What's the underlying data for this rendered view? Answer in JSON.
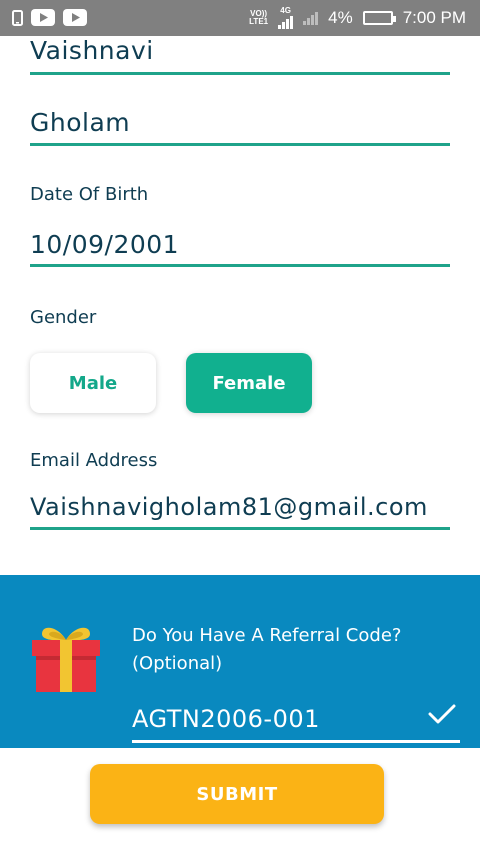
{
  "status_bar": {
    "network_top": "VO))",
    "network_bottom": "LTE1",
    "network_type": "4G",
    "battery": "4%",
    "time": "7:00 PM"
  },
  "form": {
    "first_name": "Vaishnavi",
    "last_name": "Gholam",
    "dob_label": "Date Of Birth",
    "dob_value": "10/09/2001",
    "gender_label": "Gender",
    "gender_options": [
      "Male",
      "Female"
    ],
    "gender_selected": "Female",
    "email_label": "Email Address",
    "email_value": "Vaishnavigholam81@gmail.com"
  },
  "referral": {
    "question_line1": "Do You Have A Referral Code?",
    "question_line2": "(Optional)",
    "code": "AGTN2006-001"
  },
  "submit_label": "SUBMIT",
  "colors": {
    "accent": "#11b08f",
    "referral_bg": "#0989bf",
    "submit_bg": "#fbb315",
    "text": "#0f3d52"
  }
}
